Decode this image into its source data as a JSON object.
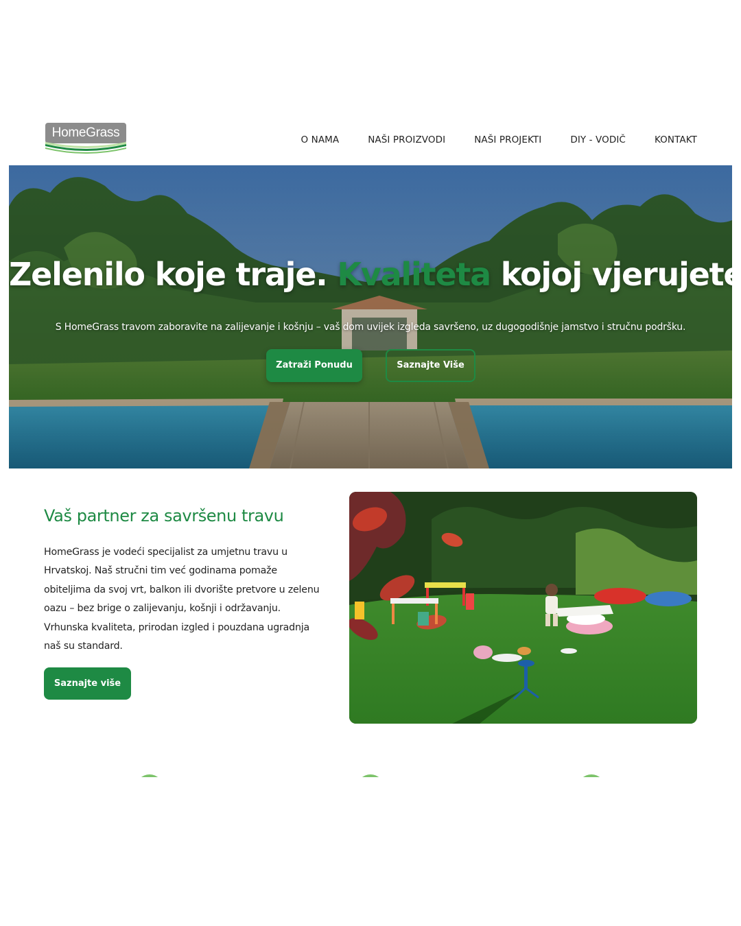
{
  "header": {
    "logo_text": "HomeGrass",
    "nav": [
      {
        "label": "O NAMA"
      },
      {
        "label": "NAŠI PROIZVODI"
      },
      {
        "label": "NAŠI PROJEKTI"
      },
      {
        "label": "DIY - VODIČ"
      },
      {
        "label": "KONTAKT"
      }
    ]
  },
  "hero": {
    "title_part1": "Zelenilo koje traje. ",
    "title_accent": "Kvaliteta",
    "title_part2": " kojoj vjerujete.",
    "subtitle": "S HomeGrass travom zaboravite na zalijevanje i košnju – vaš dom uvijek izgleda savršeno, uz dugogodišnje jamstvo i stručnu podršku.",
    "primary_button": "Zatraži Ponudu",
    "secondary_button": "Saznajte Više"
  },
  "about": {
    "title": "Vaš partner za savršenu travu",
    "text": "HomeGrass je vodeći specijalist za umjetnu travu u Hrvatskoj. Naš stručni tim već godinama pomaže obiteljima da svoj vrt, balkon ili dvorište pretvore u zelenu oazu – bez brige o zalijevanju, košnji i održavanju. Vrhunska kvaliteta, prirodan izgled i pouzdana ugradnja naš su standard.",
    "button": "Saznajte više"
  },
  "colors": {
    "brand_green": "#1e8a44",
    "logo_gray": "#8c8c8c",
    "feature_icon_green": "#7cc36a"
  }
}
